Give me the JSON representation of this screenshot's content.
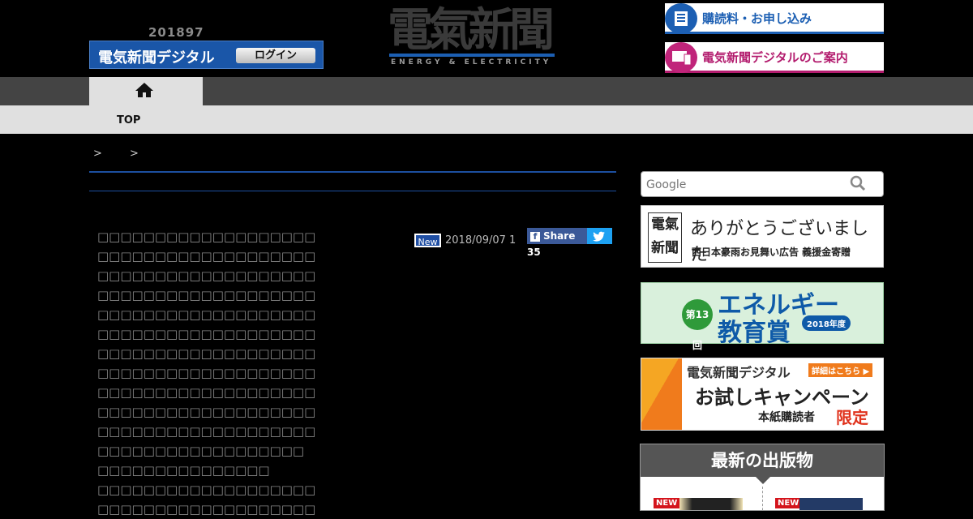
{
  "header": {
    "date_text": "201897",
    "digital_label": "電気新聞デジタル",
    "login_label": "ログイン",
    "logo_kanji": "電氣新聞",
    "logo_sub": "ENERGY & ELECTRICITY",
    "subscribe_label": "購読料・お申し込み",
    "digital_guide_label": "電気新聞デジタルのご案内"
  },
  "nav": {
    "home_label": "TOP"
  },
  "breadcrumb": "> >",
  "article": {
    "body_lines": [
      "□□□□□□□□□□□□□□□□□□□",
      "□□□□□□□□□□□□□□□□□□□",
      "□□□□□□□□□□□□□□□□□□□",
      "□□□□□□□□□□□□□□□□□□□",
      "□□□□□□□□□□□□□□□□□□□",
      "□□□□□□□□□□□□□□□□□□□",
      "□□□□□□□□□□□□□□□□□□□",
      "□□□□□□□□□□□□□□□□□□□",
      "□□□□□□□□□□□□□□□□□□□",
      "□□□□□□□□□□□□□□□□□□□",
      "□□□□□□□□□□□□□□□□□□□",
      "□□□□□□□□□□□□□□□□□□",
      "□□□□□□□□□□□□□□□",
      "□□□□□□□□□□□□□□□□□□□",
      "□□□□□□□□□□□□□□□□□□□"
    ],
    "new_badge": "New",
    "date": "2018/09/07  1",
    "share_label": "Share 35"
  },
  "sidebar": {
    "search_placeholder": "Google",
    "thanks_main": "ありがとうございました",
    "thanks_sub": "西日本豪雨お見舞い広告 義援金寄贈",
    "thanks_k1": "電氣",
    "thanks_k2": "新聞",
    "energy_circle": "第13回",
    "energy_l1": "エネルギー",
    "energy_l2": "教育賞",
    "energy_year": "2018年度",
    "trial_a": "電気新聞デジタル",
    "trial_detail": "詳細はこちら ▶",
    "trial_b": "お試しキャンペーン",
    "trial_c": "本紙購読者",
    "trial_limit": "限定",
    "pub_head": "最新の出版物",
    "pub_new": "NEW"
  },
  "colors": {
    "accent_blue": "#1c5fb3",
    "accent_pink": "#b31c6e",
    "rule_blue": "#1c4fa0"
  }
}
